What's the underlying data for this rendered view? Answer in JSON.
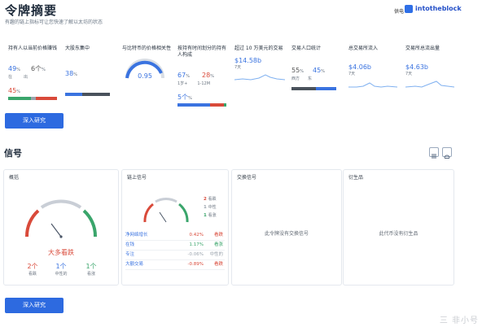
{
  "header": {
    "title": "令牌摘要",
    "subtitle": "有趣的链上指标可让您快速了解以太坊的状态",
    "powered_by": "供电",
    "brand": "intotheblock"
  },
  "metrics": [
    {
      "title": "持有人以当前价格赚钱",
      "a": "49",
      "a_label": "在",
      "b": "6个",
      "b_label": "出",
      "c": "45",
      "c_label": "%"
    },
    {
      "title": "大股东集中",
      "a": "38"
    },
    {
      "title": "与比特币的价格相关性",
      "value": "0.95"
    },
    {
      "title": "按持有时间划分的持有人构成",
      "a": "67",
      "a_label": "1岁+",
      "b": "28",
      "b_label": "1-12M",
      "c": "5个",
      "c_label": "%"
    },
    {
      "title": "超过 10 万美元的交易",
      "value": "$14.58b",
      "period": "7天"
    },
    {
      "title": "交易人口统计",
      "a": "55",
      "a_label": "西方",
      "b": "45",
      "b_label": "东"
    },
    {
      "title": "总交易所流入",
      "value": "$4.06b",
      "period": "7天"
    },
    {
      "title": "交易所总流出量",
      "value": "$4.63b",
      "period": "7天"
    }
  ],
  "research_button": "深入研究",
  "signals": {
    "title": "信号",
    "summary": {
      "head": "概括",
      "verdict": "大多看跌",
      "bear_count": "2个",
      "bear_label": "看跌",
      "neutral_count": "1个",
      "neutral_label": "中性的",
      "bull_count": "1个",
      "bull_label": "看涨"
    },
    "onchain": {
      "head": "链上信号",
      "bear_n": "2",
      "bear_label": "看跌",
      "neutral_n": "1",
      "neutral_label": "中性",
      "bull_n": "1",
      "bull_label": "看涨",
      "rows": [
        {
          "name": "净网络增长",
          "value": "0.42%",
          "status": "看跌",
          "color": "#d94a3a"
        },
        {
          "name": "在钱",
          "value": "1.17%",
          "status": "看涨",
          "color": "#3aa56b"
        },
        {
          "name": "专注",
          "value": "-0.06%",
          "status": "中性的",
          "color": "#9aa3ad"
        },
        {
          "name": "大额交易",
          "value": "-0.89%",
          "status": "看跌",
          "color": "#d94a3a"
        }
      ]
    },
    "exchange": {
      "head": "交换信号",
      "empty": "此令牌没有交换信号"
    },
    "derivatives": {
      "head": "衍生品",
      "empty": "此代币没有衍生品"
    }
  },
  "watermark": "三 非小号",
  "colors": {
    "accent": "#2d6ae0",
    "bear": "#d94a3a",
    "bull": "#3aa56b",
    "neutral": "#9aa3ad"
  }
}
